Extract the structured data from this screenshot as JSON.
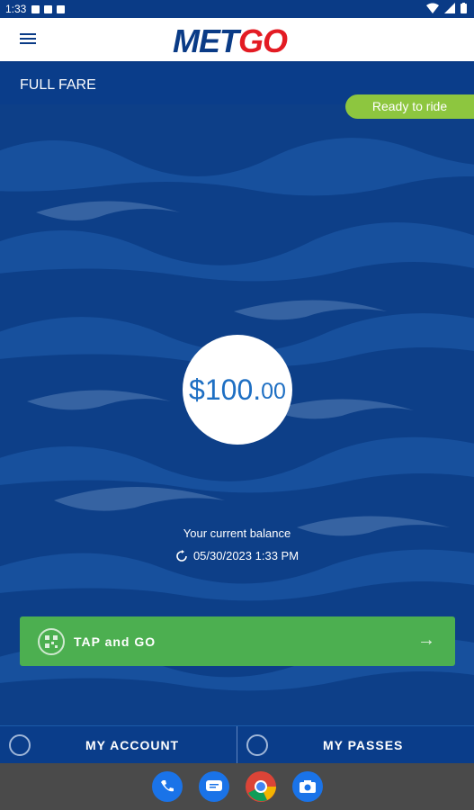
{
  "status_bar": {
    "time": "1:33"
  },
  "header": {
    "logo_met": "MET",
    "logo_go": "GO"
  },
  "fare": {
    "title": "FULL FARE",
    "badge": "Ready to ride",
    "balance_dollars": "$100.",
    "balance_cents": "00",
    "balance_label": "Your current balance",
    "timestamp": "05/30/2023 1:33 PM"
  },
  "actions": {
    "tap_button": "TAP and GO"
  },
  "nav": {
    "account": "MY ACCOUNT",
    "passes": "MY PASSES"
  },
  "icons": [
    "menu-icon",
    "refresh-icon",
    "qr-code-icon",
    "arrow-right-icon",
    "account-icon",
    "passes-icon",
    "phone-icon",
    "messages-icon",
    "chrome-icon",
    "camera-icon"
  ],
  "colors": {
    "primary": "#0a3b86",
    "accent_green": "#4caf50",
    "badge_green": "#8dc63f",
    "logo_red": "#e31b23"
  }
}
